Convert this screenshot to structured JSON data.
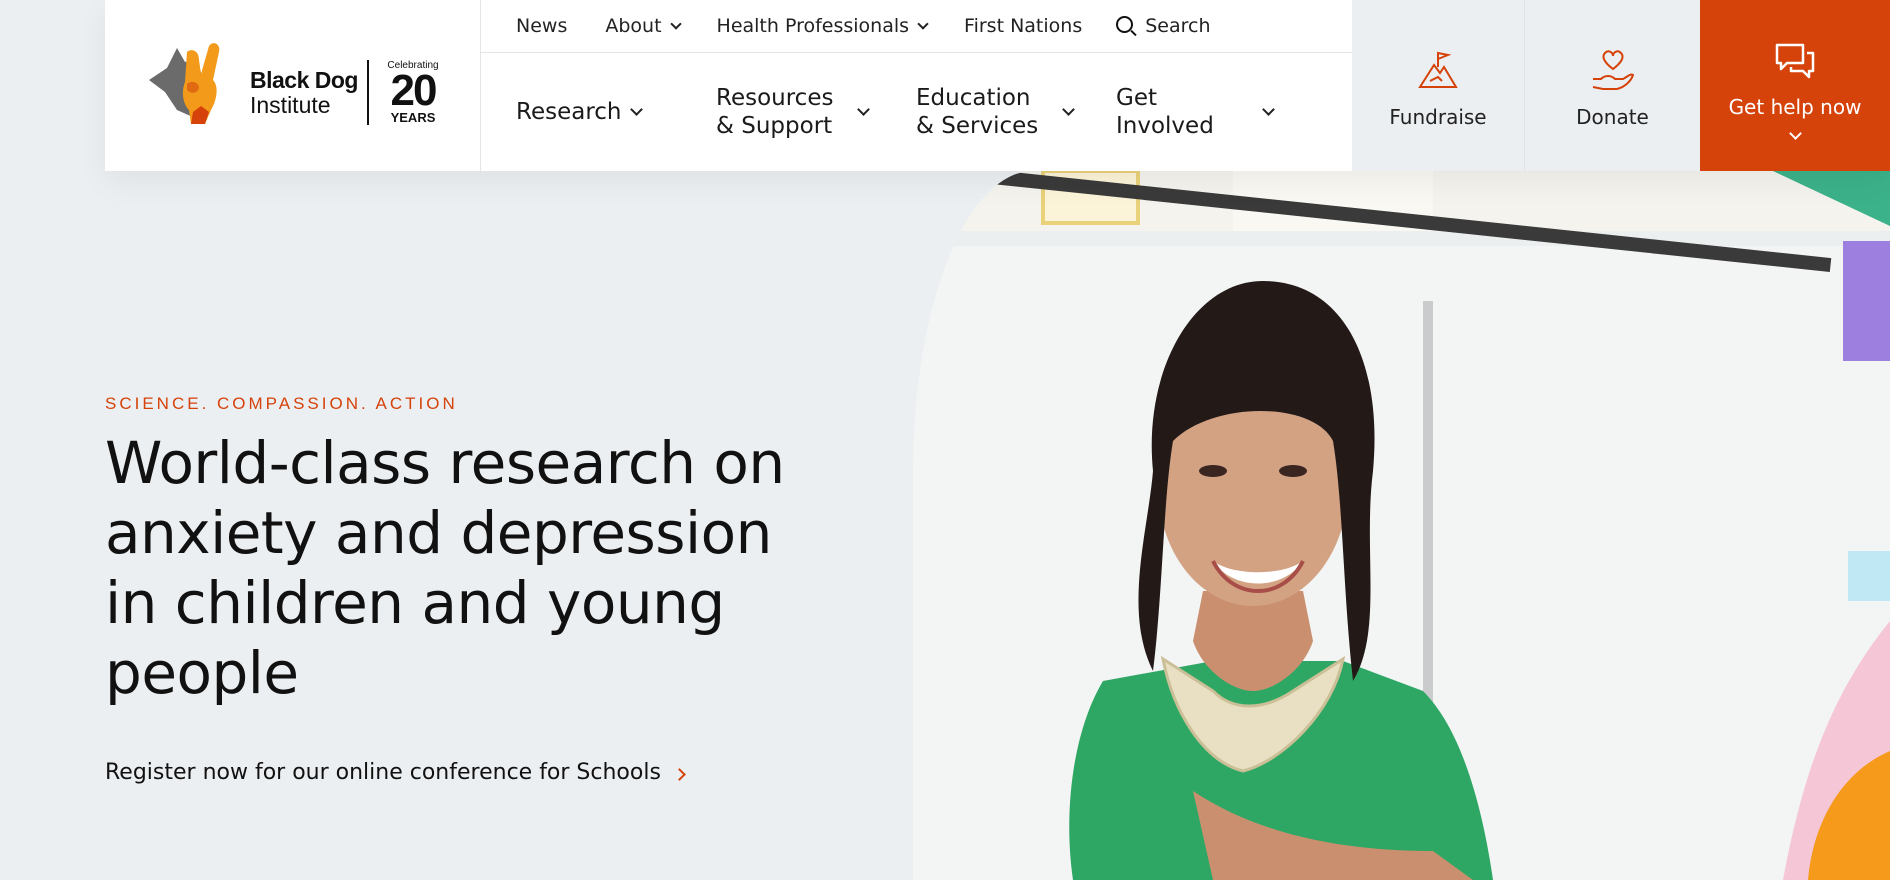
{
  "brand": {
    "name_line1": "Black Dog",
    "name_line2": "Institute",
    "celebrating": "Celebrating",
    "years_number": "20",
    "years_word": "YEARS",
    "accent_color": "#d5420a"
  },
  "top_nav": {
    "items": [
      {
        "label": "News"
      },
      {
        "label": "About"
      },
      {
        "label": "Health Professionals"
      },
      {
        "label": "First Nations"
      }
    ],
    "search_label": "Search"
  },
  "main_nav": {
    "items": [
      {
        "label": "Research"
      },
      {
        "label": "Resources\n& Support"
      },
      {
        "label": "Education\n& Services"
      },
      {
        "label": "Get\nInvolved"
      }
    ]
  },
  "actions": {
    "fundraise": {
      "label": "Fundraise",
      "icon": "mountain-flag-icon"
    },
    "donate": {
      "label": "Donate",
      "icon": "hand-heart-icon"
    },
    "get_help": {
      "label": "Get help now",
      "icon": "chat-bubbles-icon"
    }
  },
  "hero": {
    "eyebrow": "SCIENCE. COMPASSION. ACTION",
    "headline_line1": "World-class research on",
    "headline_line2": "anxiety and depression",
    "headline_line3": "in children and young",
    "headline_line4": "people",
    "cta": "Register now for our online conference for Schools"
  }
}
